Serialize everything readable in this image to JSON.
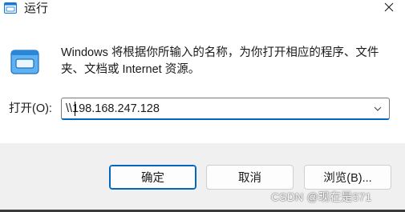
{
  "window": {
    "title": "运行",
    "app_icon": "run-icon",
    "close_icon": "close-icon"
  },
  "content": {
    "icon": "run-dialog-icon",
    "description": "Windows 将根据你所输入的名称，为你打开相应的程序、文件夹、文档或 Internet 资源。",
    "open_label": "打开(O):",
    "open_value": "\\\\198.168.247.128",
    "dropdown_icon": "chevron-down-icon"
  },
  "buttons": {
    "ok_label": "确定",
    "cancel_label": "取消",
    "browse_label": "浏览(B)..."
  },
  "watermark": "CSDN @现在是571",
  "colors": {
    "accent": "#0067c0",
    "footer_bg": "#f0f0f0"
  }
}
